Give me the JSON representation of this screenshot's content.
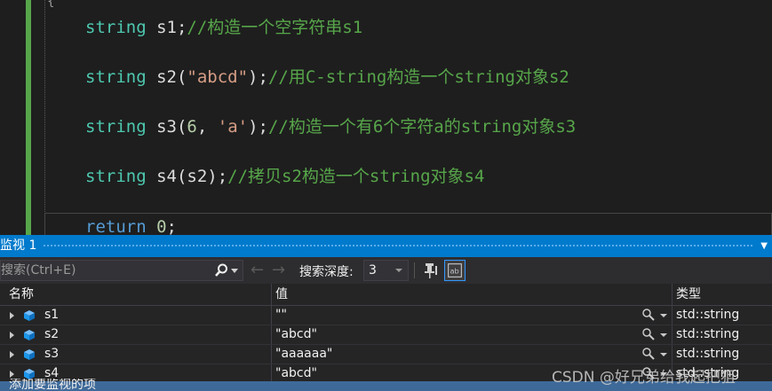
{
  "editor": {
    "brace": "{",
    "lines": [
      {
        "type_kw": "string",
        "decl": " s1",
        "punct": ";",
        "comment": "//构造一个空字符串s1"
      },
      {
        "type_kw": "string",
        "decl": " s2(",
        "str": "\"abcd\"",
        "punct": ");",
        "comment": "//用C-string构造一个string对象s2"
      },
      {
        "type_kw": "string",
        "decl": " s3(",
        "num": "6",
        "mid": ", ",
        "str": "'a'",
        "punct": ");",
        "comment": "//构造一个有6个字符a的string对象s3"
      },
      {
        "type_kw": "string",
        "decl": " s4(s2)",
        "punct": ";",
        "comment": "//拷贝s2构造一个string对象s4"
      }
    ],
    "return_kw": "return",
    "return_num": "0",
    "return_punct": ";"
  },
  "watch": {
    "title": "监视 1",
    "search": {
      "placeholder": "搜索(Ctrl+E)"
    },
    "depth_label": "搜索深度:",
    "depth_value": "3",
    "columns": {
      "name": "名称",
      "value": "值",
      "type": "类型"
    },
    "rows": [
      {
        "name": "s1",
        "value": "\"\"",
        "type": "std::string"
      },
      {
        "name": "s2",
        "value": "\"abcd\"",
        "type": "std::string"
      },
      {
        "name": "s3",
        "value": "\"aaaaaa\"",
        "type": "std::string"
      },
      {
        "name": "s4",
        "value": "\"abcd\"",
        "type": "std::string"
      }
    ],
    "add_item": "添加要监视的项"
  },
  "watermark": "CSDN @好兄弟给我起把狙",
  "colors": {
    "accent": "#007acc",
    "comment": "#57a64a",
    "type_kw": "#4ec9b0",
    "string": "#d69d85"
  }
}
